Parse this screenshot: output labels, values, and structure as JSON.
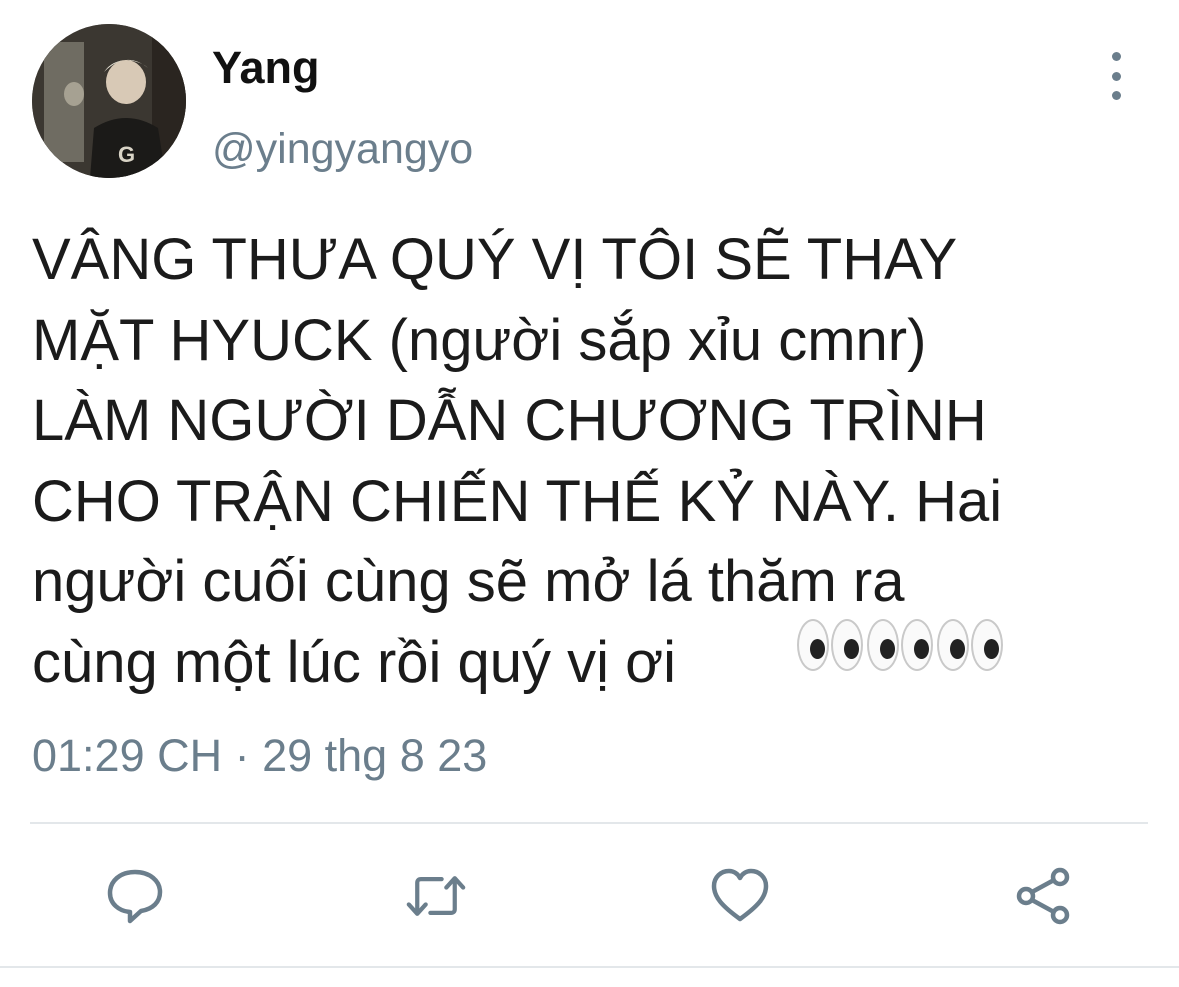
{
  "user": {
    "display_name": "Yang",
    "handle": "@yingyangyo",
    "avatar": "user-avatar-photo"
  },
  "tweet": {
    "lines": [
      "VÂNG THƯA QUÝ VỊ TÔI SẼ THAY",
      "MẶT HYUCK (người sắp xỉu cmnr)",
      "LÀM NGƯỜI DẪN CHƯƠNG TRÌNH",
      "CHO TRẬN CHIẾN THẾ KỶ NÀY. Hai",
      "người cuối cùng sẽ mở lá thăm ra",
      "cùng một lúc rồi quý vị ơi"
    ],
    "emoji": [
      "eyes-emoji",
      "eyes-emoji",
      "eyes-emoji"
    ],
    "timestamp": "01:29 CH · 29 thg 8 23"
  },
  "icons": {
    "more": "more-vertical-icon",
    "reply": "reply-icon",
    "retweet": "retweet-icon",
    "like": "heart-icon",
    "share": "share-icon"
  },
  "colors": {
    "text": "#1b1b1b",
    "secondary": "#6b7e8c",
    "divider": "#e3e7ea"
  }
}
